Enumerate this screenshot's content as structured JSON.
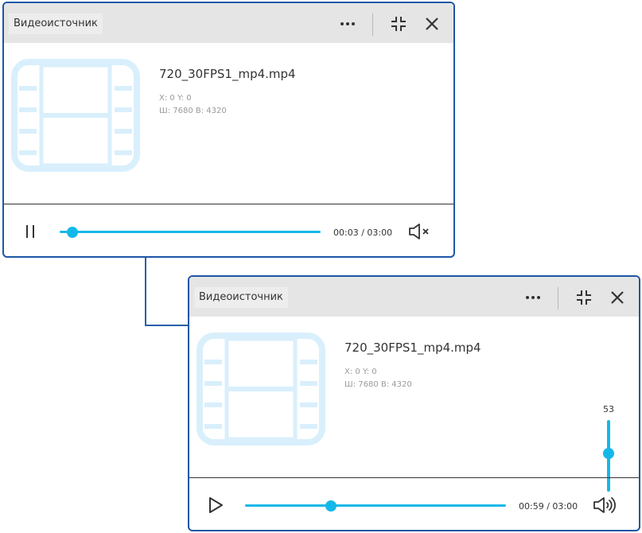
{
  "accent_color": "#14b8e8",
  "thumbnail_color": "#d9effc",
  "panels": [
    {
      "title": "Видеоисточник",
      "filename": "720_30FPS1_mp4.mp4",
      "coords": "X: 0 Y: 0",
      "dims": "Ш: 7680 В: 4320",
      "play_state": "pause-icon",
      "progress": 0.05,
      "time": "00:03 / 03:00",
      "volume_icon": "volume-muted-icon",
      "volume_popup": null
    },
    {
      "title": "Видеоисточник",
      "filename": "720_30FPS1_mp4.mp4",
      "coords": "X: 0 Y: 0",
      "dims": "Ш: 7680 В: 4320",
      "play_state": "play-icon",
      "progress": 0.33,
      "time": "00:59 / 03:00",
      "volume_icon": "volume-high-icon",
      "volume_popup": {
        "value": "53",
        "level": 0.53
      }
    }
  ]
}
